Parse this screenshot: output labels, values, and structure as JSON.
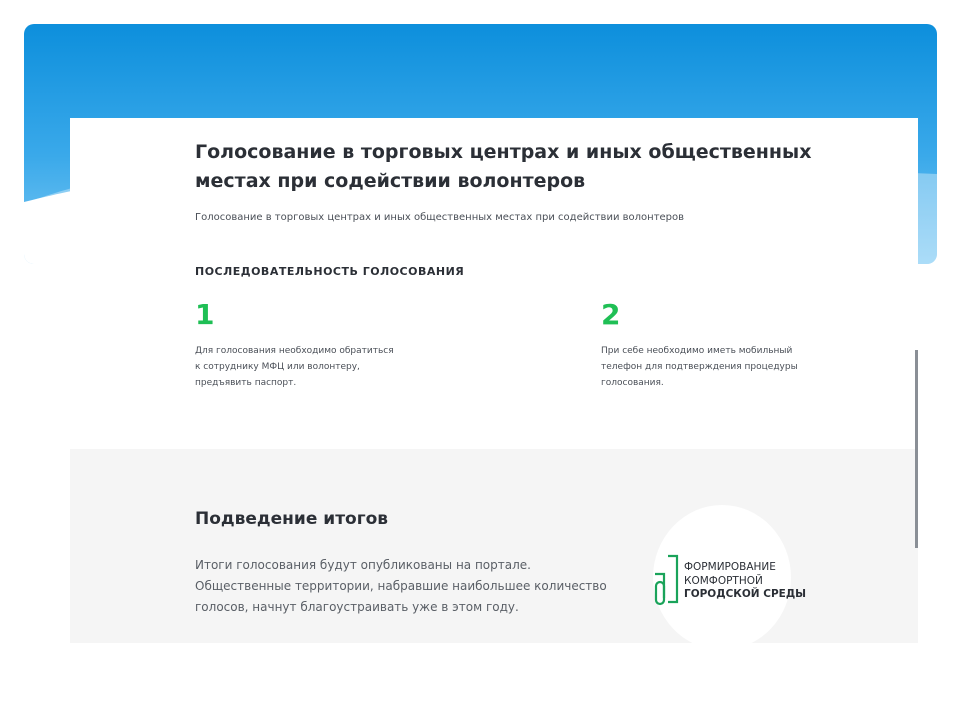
{
  "voting": {
    "title": "Голосование в торговых центрах и иных общественных местах при содействии волонтеров",
    "subtitle": "Голосование в торговых центрах и иных общественных местах при содействии волонтеров",
    "sequence_title": "ПОСЛЕДОВАТЕЛЬНОСТЬ ГОЛОСОВАНИЯ",
    "steps": [
      {
        "number": "1",
        "text": "Для голосования необходимо обратиться к сотруднику МФЦ или волонтеру, предъявить паспорт."
      },
      {
        "number": "2",
        "text": "При себе необходимо иметь мобильный телефон для подтверждения процедуры голосования."
      }
    ]
  },
  "results": {
    "title": "Подведение итогов",
    "text": "Итоги голосования будут опубликованы на портале. Общественные территории, набравшие наибольшее количество голосов, начнут благоустраивать уже в этом году."
  },
  "logo": {
    "line1": "ФОРМИРОВАНИЕ",
    "line2": "КОМФОРТНОЙ",
    "line3": "ГОРОДСКОЙ СРЕДЫ",
    "icon": "building-logo-icon",
    "color": "#1aa35a"
  },
  "colors": {
    "accent_green": "#1fbf55",
    "header_blue": "#0d8fdc"
  }
}
